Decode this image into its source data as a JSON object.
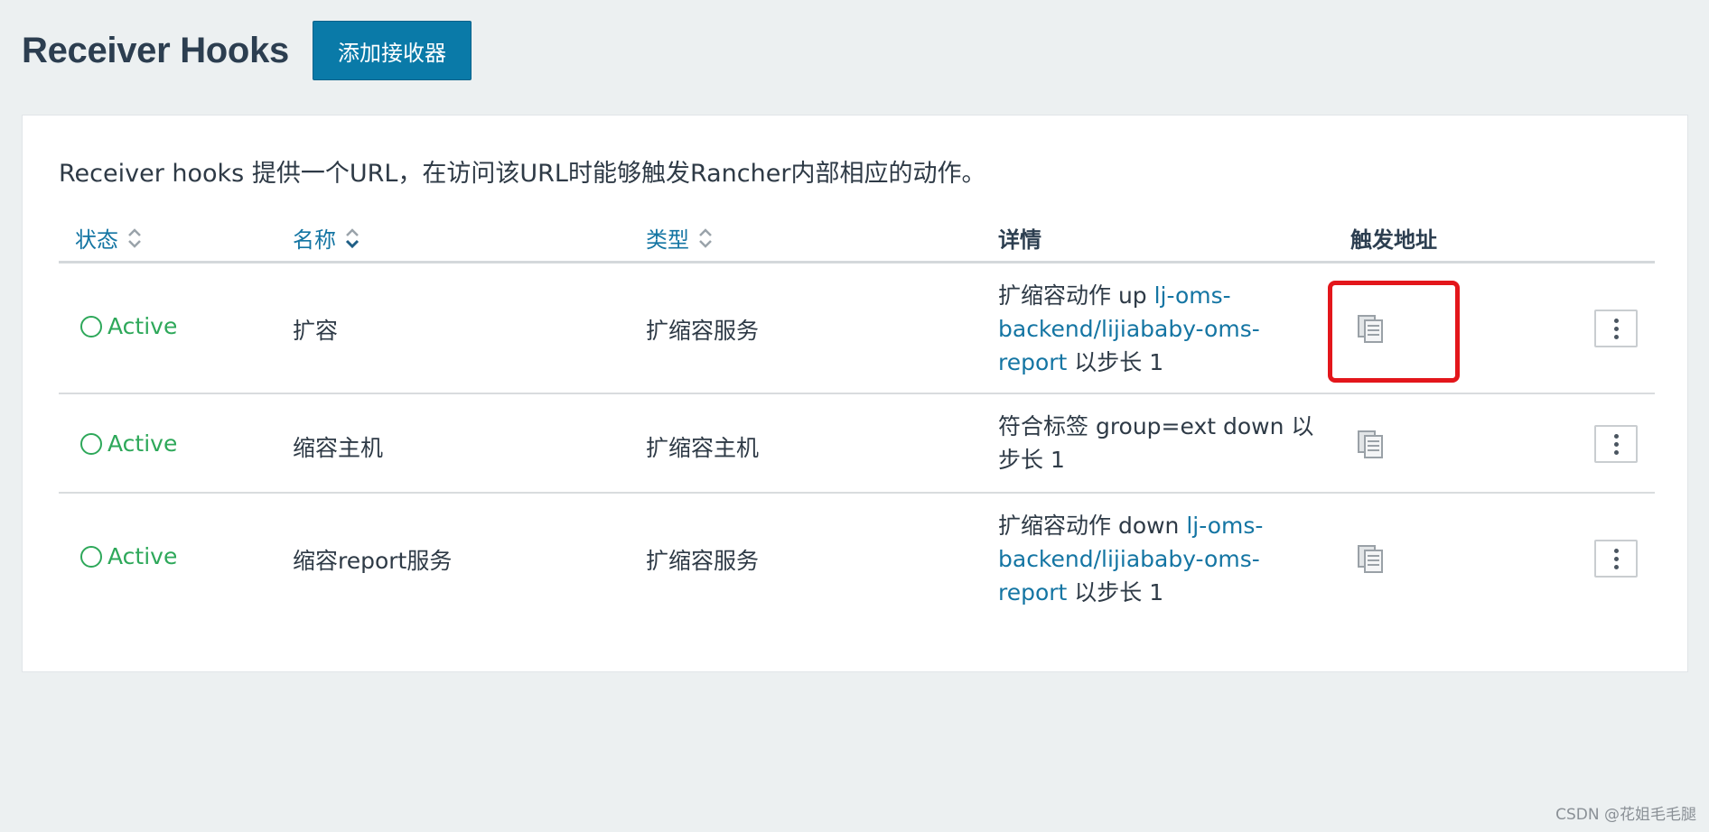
{
  "header": {
    "title": "Receiver Hooks",
    "add_button_label": "添加接收器"
  },
  "panel": {
    "description": "Receiver hooks 提供一个URL，在访问该URL时能够触发Rancher内部相应的动作。"
  },
  "table": {
    "columns": {
      "state": "状态",
      "name": "名称",
      "type": "类型",
      "details": "详情",
      "trigger_url": "触发地址"
    },
    "rows": [
      {
        "state": "Active",
        "name": "扩容",
        "type": "扩缩容服务",
        "details_prefix": "扩缩容动作 up ",
        "details_link": "lj-oms-backend/lijiababy-oms-report",
        "details_suffix": " 以步长 1"
      },
      {
        "state": "Active",
        "name": "缩容主机",
        "type": "扩缩容主机",
        "details_prefix": "符合标签 group=ext down 以步长 1",
        "details_link": "",
        "details_suffix": ""
      },
      {
        "state": "Active",
        "name": "缩容report服务",
        "type": "扩缩容服务",
        "details_prefix": "扩缩容动作 down ",
        "details_link": "lj-oms-backend/lijiababy-oms-report",
        "details_suffix": " 以步长 1"
      }
    ]
  },
  "icons": {
    "sort": "sort-icon",
    "copy": "copy-icon",
    "menu": "vertical-dots-icon",
    "status": "circle-icon"
  },
  "colors": {
    "accent": "#0a7aa8",
    "link": "#1475a3",
    "active": "#2ea85a",
    "highlight": "#e3161b"
  },
  "watermark": "CSDN @花姐毛毛腿"
}
